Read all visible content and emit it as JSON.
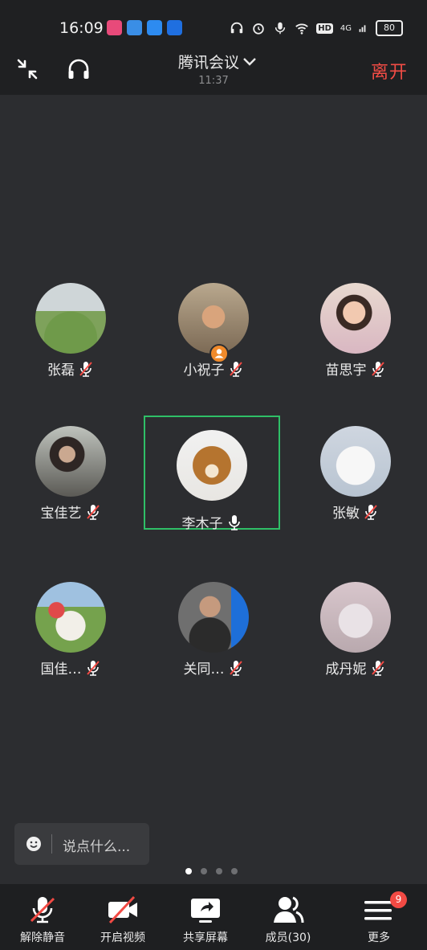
{
  "status_bar": {
    "time": "16:09",
    "battery": "80",
    "network": "4G",
    "hd": "HD"
  },
  "header": {
    "title": "腾讯会议",
    "elapsed": "11:37",
    "leave_label": "离开"
  },
  "participants": [
    {
      "name": "张磊",
      "muted": true,
      "avatar": "horses-photo"
    },
    {
      "name": "小祝子",
      "muted": true,
      "avatar": "child-sunglasses-photo",
      "host": true
    },
    {
      "name": "苗思宇",
      "muted": true,
      "avatar": "little-girl-photo"
    },
    {
      "name": "宝佳艺",
      "muted": true,
      "avatar": "woman-photo"
    },
    {
      "name": "李木子",
      "muted": false,
      "avatar": "cat-photo",
      "active": true
    },
    {
      "name": "张敏",
      "muted": true,
      "avatar": "white-dog-photo"
    },
    {
      "name": "国佳…",
      "muted": true,
      "avatar": "watermelon-photo"
    },
    {
      "name": "关同…",
      "muted": true,
      "avatar": "man-glasses-photo"
    },
    {
      "name": "成丹妮",
      "muted": true,
      "avatar": "veiled-figure-photo"
    }
  ],
  "chat": {
    "placeholder": "说点什么..."
  },
  "pager": {
    "pages": 4,
    "current": 1
  },
  "toolbar": {
    "unmute": "解除静音",
    "video": "开启视频",
    "share": "共享屏幕",
    "members": "成员(30)",
    "more": "更多",
    "more_badge": "9"
  },
  "colors": {
    "accent_green": "#2fbf67",
    "leave_red": "#f24c45",
    "background": "#2c2d30"
  }
}
